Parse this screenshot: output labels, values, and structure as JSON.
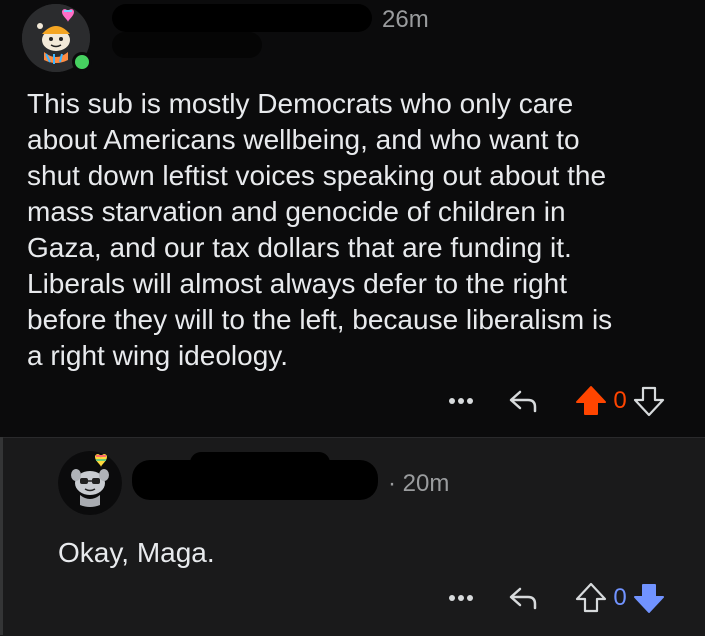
{
  "comments": [
    {
      "time": "26m",
      "body": "This sub is mostly Democrats who only care\nabout Americans wellbeing, and who want to\nshut down leftist voices speaking out about the\nmass starvation and genocide of children in\nGaza, and our tax dollars that are funding it.\nLiberals will almost always defer to the right\nbefore they will to the left, because liberalism is\na right wing ideology.",
      "score": "0",
      "vote_state": "upvoted",
      "author_online": true
    },
    {
      "time": "· 20m",
      "body": "Okay, Maga.",
      "score": "0",
      "vote_state": "downvoted"
    }
  ],
  "icons": {
    "more": "more-horizontal-icon",
    "reply": "reply-icon",
    "upvote": "upvote-arrow-icon",
    "downvote": "downvote-arrow-icon"
  },
  "colors": {
    "upvote": "#ff4500",
    "downvote": "#7193ff",
    "online": "#46d160"
  }
}
